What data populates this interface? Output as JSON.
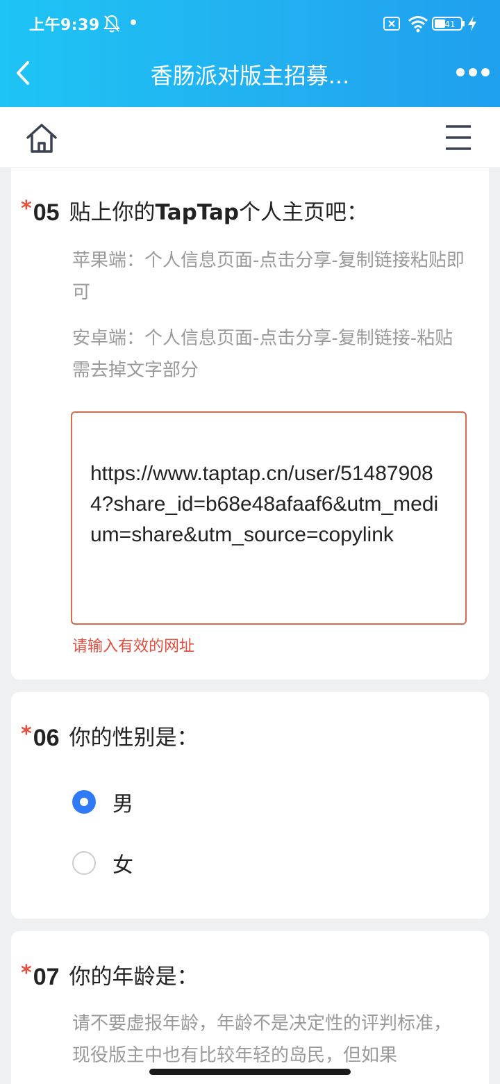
{
  "status_bar": {
    "time": "上午9:39",
    "battery_level": "41"
  },
  "nav": {
    "title": "香肠派对版主招募..."
  },
  "questions": {
    "q5": {
      "star": "*",
      "number": "05",
      "text_prefix": "贴上你的",
      "text_bold": "TapTap",
      "text_suffix": "个人主页吧：",
      "hint_ios": "苹果端：个人信息页面-点击分享-复制链接粘贴即可",
      "hint_android": "安卓端：个人信息页面-点击分享-复制链接-粘贴需去掉文字部分",
      "input_value": "https://www.taptap.cn/user/514879084?share_id=b68e48afaaf6&utm_medium=share&utm_source=copylink",
      "error": "请输入有效的网址"
    },
    "q6": {
      "star": "*",
      "number": "06",
      "text": "你的性别是：",
      "options": [
        {
          "label": "男",
          "selected": true
        },
        {
          "label": "女",
          "selected": false
        }
      ]
    },
    "q7": {
      "star": "*",
      "number": "07",
      "text": "你的年龄是：",
      "hint": "请不要虚报年龄，年龄不是决定性的评判标准，现役版主中也有比较年轻的岛民，但如果"
    }
  },
  "colors": {
    "header_gradient_start": "#1ec4f4",
    "header_gradient_end": "#1f9fee",
    "required_star": "#e74c3c",
    "error_text": "#e74c3c",
    "radio_selected": "#2f7af7",
    "input_border_error": "#d46a4a"
  },
  "icons": {
    "back": "chevron-left-icon",
    "more": "more-dots-icon",
    "home": "home-icon",
    "menu": "hamburger-menu-icon"
  }
}
